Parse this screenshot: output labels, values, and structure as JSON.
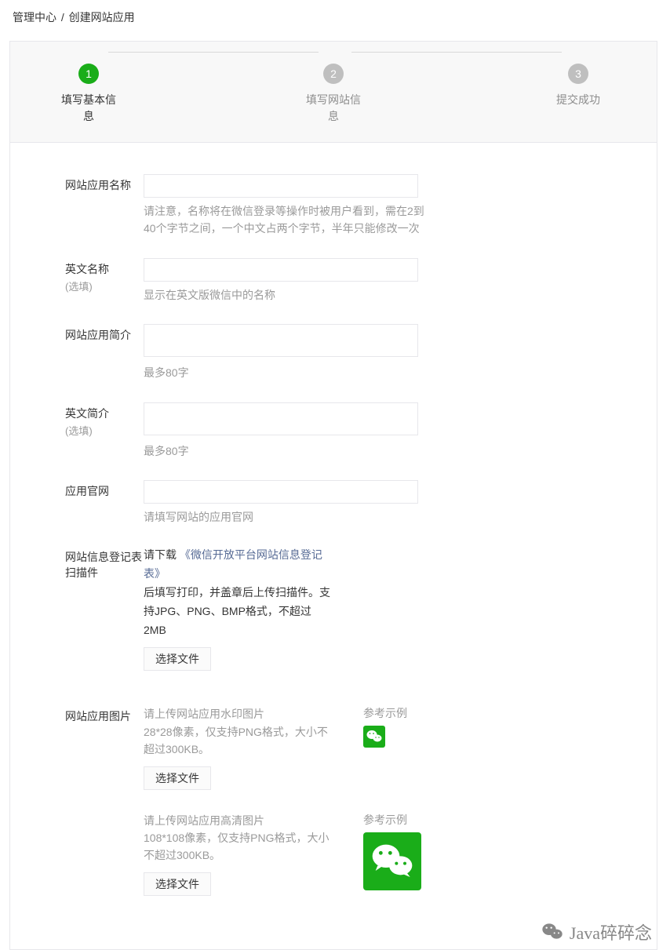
{
  "breadcrumb": {
    "item1": "管理中心",
    "sep": "/",
    "item2": "创建网站应用"
  },
  "steps": {
    "s1": {
      "num": "1",
      "label": "填写基本信息"
    },
    "s2": {
      "num": "2",
      "label": "填写网站信息"
    },
    "s3": {
      "num": "3",
      "label": "提交成功"
    }
  },
  "form": {
    "appName": {
      "label": "网站应用名称",
      "hint": "请注意，名称将在微信登录等操作时被用户看到，需在2到40个字节之间，一个中文占两个字节，半年只能修改一次"
    },
    "enName": {
      "label": "英文名称",
      "optional": "(选填)",
      "hint": "显示在英文版微信中的名称"
    },
    "appDesc": {
      "label": "网站应用简介",
      "hint": "最多80字"
    },
    "enDesc": {
      "label": "英文简介",
      "optional": "(选填)",
      "hint": "最多80字"
    },
    "website": {
      "label": "应用官网",
      "hint": "请填写网站的应用官网"
    },
    "scanFile": {
      "label": "网站信息登记表扫描件",
      "prefix": "请下载",
      "link": "《微信开放平台网站信息登记表》",
      "text": "后填写打印，并盖章后上传扫描件。支持JPG、PNG、BMP格式，不超过2MB",
      "button": "选择文件"
    },
    "appImage": {
      "label": "网站应用图片",
      "small": {
        "text1": "请上传网站应用水印图片",
        "text2": "28*28像素，仅支持PNG格式，大小不超过300KB。",
        "button": "选择文件",
        "example": "参考示例"
      },
      "large": {
        "text1": "请上传网站应用高清图片",
        "text2": "108*108像素，仅支持PNG格式，大小不超过300KB。",
        "button": "选择文件",
        "example": "参考示例"
      }
    }
  },
  "watermark": "Java碎碎念"
}
